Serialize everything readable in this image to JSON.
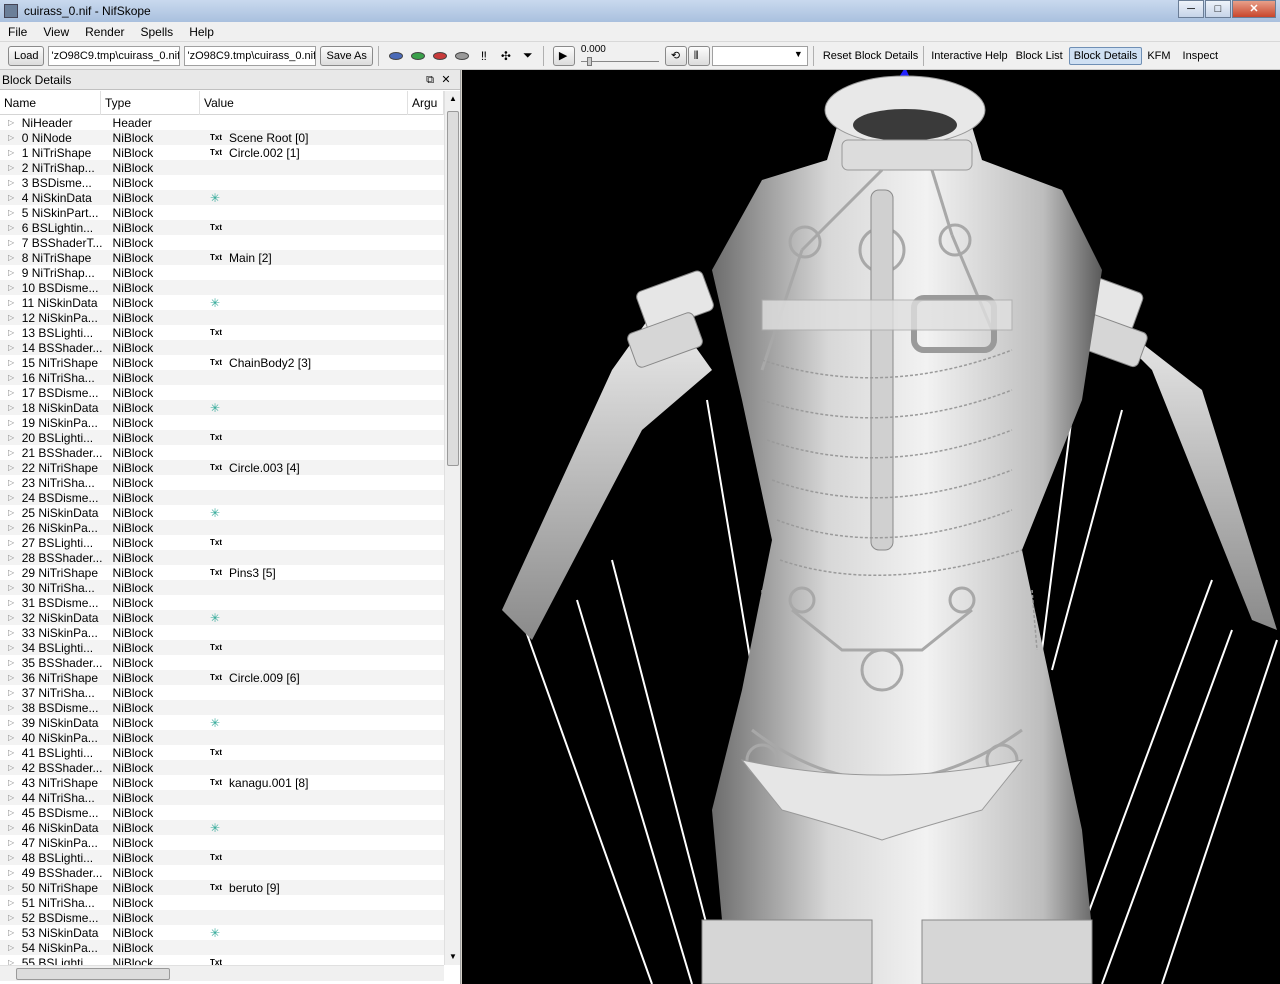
{
  "window": {
    "title": "cuirass_0.nif - NifSkope",
    "minimize": "─",
    "maximize": "□",
    "close": "✕"
  },
  "menu": [
    "File",
    "View",
    "Render",
    "Spells",
    "Help"
  ],
  "toolbar": {
    "load_label": "Load",
    "load_path": "'zO98C9.tmp\\cuirass_0.nif",
    "save_path": "'zO98C9.tmp\\cuirass_0.nif",
    "save_as_label": "Save As",
    "time_value": "0.000",
    "reset_label": "Reset Block Details",
    "help_label": "Interactive Help",
    "block_list_label": "Block List",
    "block_details_label": "Block Details",
    "kfm_label": "KFM",
    "inspect_label": "Inspect"
  },
  "panel": {
    "title": "Block Details",
    "float": "⧉",
    "close": "✕",
    "columns": [
      "Name",
      "Type",
      "Value",
      "Argu"
    ],
    "rows": [
      {
        "name": "NiHeader",
        "type": "Header",
        "kind": "",
        "value": ""
      },
      {
        "name": "0 NiNode",
        "type": "NiBlock",
        "kind": "txt",
        "value": "Scene Root [0]"
      },
      {
        "name": "1 NiTriShape",
        "type": "NiBlock",
        "kind": "txt",
        "value": "Circle.002 [1]"
      },
      {
        "name": "2 NiTriShap...",
        "type": "NiBlock",
        "kind": "",
        "value": ""
      },
      {
        "name": "3 BSDisme...",
        "type": "NiBlock",
        "kind": "",
        "value": ""
      },
      {
        "name": "4 NiSkinData",
        "type": "NiBlock",
        "kind": "star",
        "value": ""
      },
      {
        "name": "5 NiSkinPart...",
        "type": "NiBlock",
        "kind": "",
        "value": ""
      },
      {
        "name": "6 BSLightin...",
        "type": "NiBlock",
        "kind": "txt",
        "value": ""
      },
      {
        "name": "7 BSShaderT...",
        "type": "NiBlock",
        "kind": "",
        "value": ""
      },
      {
        "name": "8 NiTriShape",
        "type": "NiBlock",
        "kind": "txt",
        "value": "Main [2]"
      },
      {
        "name": "9 NiTriShap...",
        "type": "NiBlock",
        "kind": "",
        "value": ""
      },
      {
        "name": "10 BSDisme...",
        "type": "NiBlock",
        "kind": "",
        "value": ""
      },
      {
        "name": "11 NiSkinData",
        "type": "NiBlock",
        "kind": "star",
        "value": ""
      },
      {
        "name": "12 NiSkinPa...",
        "type": "NiBlock",
        "kind": "",
        "value": ""
      },
      {
        "name": "13 BSLighti...",
        "type": "NiBlock",
        "kind": "txt",
        "value": ""
      },
      {
        "name": "14 BSShader...",
        "type": "NiBlock",
        "kind": "",
        "value": ""
      },
      {
        "name": "15 NiTriShape",
        "type": "NiBlock",
        "kind": "txt",
        "value": "ChainBody2 [3]"
      },
      {
        "name": "16 NiTriSha...",
        "type": "NiBlock",
        "kind": "",
        "value": ""
      },
      {
        "name": "17 BSDisme...",
        "type": "NiBlock",
        "kind": "",
        "value": ""
      },
      {
        "name": "18 NiSkinData",
        "type": "NiBlock",
        "kind": "star",
        "value": ""
      },
      {
        "name": "19 NiSkinPa...",
        "type": "NiBlock",
        "kind": "",
        "value": ""
      },
      {
        "name": "20 BSLighti...",
        "type": "NiBlock",
        "kind": "txt",
        "value": ""
      },
      {
        "name": "21 BSShader...",
        "type": "NiBlock",
        "kind": "",
        "value": ""
      },
      {
        "name": "22 NiTriShape",
        "type": "NiBlock",
        "kind": "txt",
        "value": "Circle.003 [4]"
      },
      {
        "name": "23 NiTriSha...",
        "type": "NiBlock",
        "kind": "",
        "value": ""
      },
      {
        "name": "24 BSDisme...",
        "type": "NiBlock",
        "kind": "",
        "value": ""
      },
      {
        "name": "25 NiSkinData",
        "type": "NiBlock",
        "kind": "star",
        "value": ""
      },
      {
        "name": "26 NiSkinPa...",
        "type": "NiBlock",
        "kind": "",
        "value": ""
      },
      {
        "name": "27 BSLighti...",
        "type": "NiBlock",
        "kind": "txt",
        "value": ""
      },
      {
        "name": "28 BSShader...",
        "type": "NiBlock",
        "kind": "",
        "value": ""
      },
      {
        "name": "29 NiTriShape",
        "type": "NiBlock",
        "kind": "txt",
        "value": "Pins3 [5]"
      },
      {
        "name": "30 NiTriSha...",
        "type": "NiBlock",
        "kind": "",
        "value": ""
      },
      {
        "name": "31 BSDisme...",
        "type": "NiBlock",
        "kind": "",
        "value": ""
      },
      {
        "name": "32 NiSkinData",
        "type": "NiBlock",
        "kind": "star",
        "value": ""
      },
      {
        "name": "33 NiSkinPa...",
        "type": "NiBlock",
        "kind": "",
        "value": ""
      },
      {
        "name": "34 BSLighti...",
        "type": "NiBlock",
        "kind": "txt",
        "value": ""
      },
      {
        "name": "35 BSShader...",
        "type": "NiBlock",
        "kind": "",
        "value": ""
      },
      {
        "name": "36 NiTriShape",
        "type": "NiBlock",
        "kind": "txt",
        "value": "Circle.009 [6]"
      },
      {
        "name": "37 NiTriSha...",
        "type": "NiBlock",
        "kind": "",
        "value": ""
      },
      {
        "name": "38 BSDisme...",
        "type": "NiBlock",
        "kind": "",
        "value": ""
      },
      {
        "name": "39 NiSkinData",
        "type": "NiBlock",
        "kind": "star",
        "value": ""
      },
      {
        "name": "40 NiSkinPa...",
        "type": "NiBlock",
        "kind": "",
        "value": ""
      },
      {
        "name": "41 BSLighti...",
        "type": "NiBlock",
        "kind": "txt",
        "value": ""
      },
      {
        "name": "42 BSShader...",
        "type": "NiBlock",
        "kind": "",
        "value": ""
      },
      {
        "name": "43 NiTriShape",
        "type": "NiBlock",
        "kind": "txt",
        "value": "kanagu.001 [8]"
      },
      {
        "name": "44 NiTriSha...",
        "type": "NiBlock",
        "kind": "",
        "value": ""
      },
      {
        "name": "45 BSDisme...",
        "type": "NiBlock",
        "kind": "",
        "value": ""
      },
      {
        "name": "46 NiSkinData",
        "type": "NiBlock",
        "kind": "star",
        "value": ""
      },
      {
        "name": "47 NiSkinPa...",
        "type": "NiBlock",
        "kind": "",
        "value": ""
      },
      {
        "name": "48 BSLighti...",
        "type": "NiBlock",
        "kind": "txt",
        "value": ""
      },
      {
        "name": "49 BSShader...",
        "type": "NiBlock",
        "kind": "",
        "value": ""
      },
      {
        "name": "50 NiTriShape",
        "type": "NiBlock",
        "kind": "txt",
        "value": "beruto [9]"
      },
      {
        "name": "51 NiTriSha...",
        "type": "NiBlock",
        "kind": "",
        "value": ""
      },
      {
        "name": "52 BSDisme...",
        "type": "NiBlock",
        "kind": "",
        "value": ""
      },
      {
        "name": "53 NiSkinData",
        "type": "NiBlock",
        "kind": "star",
        "value": ""
      },
      {
        "name": "54 NiSkinPa...",
        "type": "NiBlock",
        "kind": "",
        "value": ""
      },
      {
        "name": "55 BSLighti...",
        "type": "NiBlock",
        "kind": "txt",
        "value": ""
      }
    ]
  },
  "txt_tag": "Txt",
  "star_glyph": "✳",
  "colors": {
    "viewport_bg": "#000000",
    "mesh": "#e6e6e6",
    "bone_white": "#ffffff",
    "bone_blue": "#1a1aff"
  }
}
